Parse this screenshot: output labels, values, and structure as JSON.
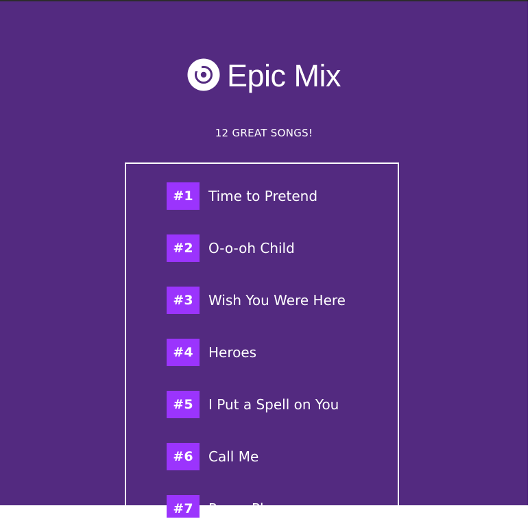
{
  "header": {
    "icon": "disc-icon",
    "title": "Epic Mix"
  },
  "subtitle": "12 GREAT SONGS!",
  "tracks": [
    {
      "number": "#1",
      "title": "Time to Pretend"
    },
    {
      "number": "#2",
      "title": "O-o-oh Child"
    },
    {
      "number": "#3",
      "title": "Wish You Were Here"
    },
    {
      "number": "#4",
      "title": "Heroes"
    },
    {
      "number": "#5",
      "title": "I Put a Spell on You"
    },
    {
      "number": "#6",
      "title": "Call Me"
    },
    {
      "number": "#7",
      "title": "Paper Planes"
    }
  ],
  "colors": {
    "background": "#532a80",
    "track_badge": "#9b34fd",
    "text": "#ffffff",
    "border": "#ffffff"
  }
}
